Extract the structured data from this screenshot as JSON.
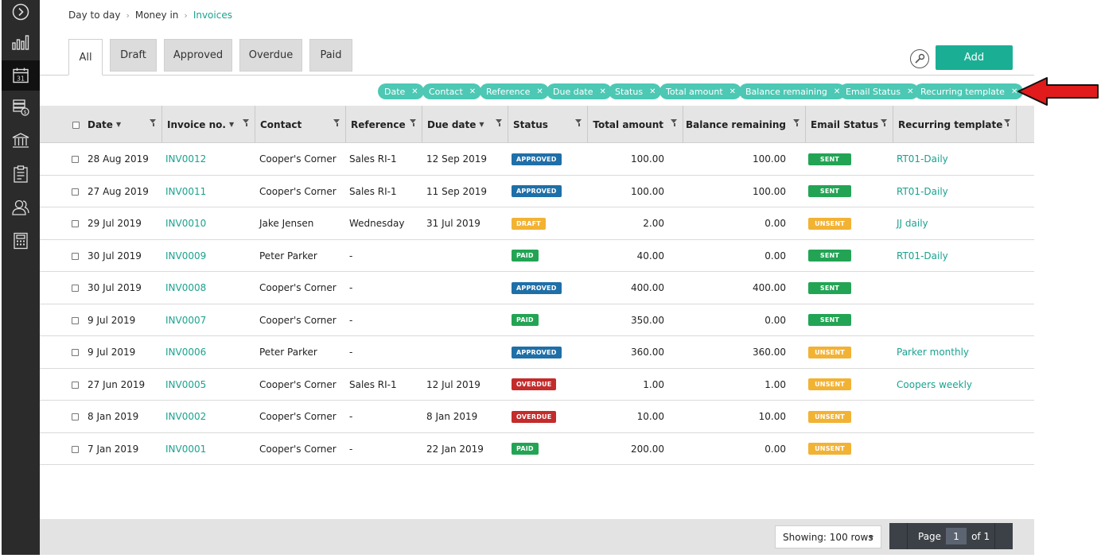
{
  "sidebar": {
    "items": [
      {
        "icon": "chevron-right-circle-icon"
      },
      {
        "icon": "bar-chart-icon"
      },
      {
        "icon": "calendar-icon",
        "text": "31",
        "active": true
      },
      {
        "icon": "money-stack-icon"
      },
      {
        "icon": "bank-icon"
      },
      {
        "icon": "clipboard-icon"
      },
      {
        "icon": "contacts-icon"
      },
      {
        "icon": "calculator-icon"
      }
    ]
  },
  "breadcrumb": {
    "items": [
      "Day to day",
      "Money in"
    ],
    "current": "Invoices"
  },
  "tabs": [
    "All",
    "Draft",
    "Approved",
    "Overdue",
    "Paid"
  ],
  "toolbar": {
    "add_label": "Add"
  },
  "column_chips": [
    "Date",
    "Contact",
    "Reference",
    "Due date",
    "Status",
    "Total amount",
    "Balance remaining",
    "Email Status",
    "Recurring template"
  ],
  "table": {
    "headers": [
      "Date",
      "Invoice no.",
      "Contact",
      "Reference",
      "Due date",
      "Status",
      "Total amount",
      "Balance remaining",
      "Email Status",
      "Recurring template"
    ],
    "rows": [
      {
        "date": "28 Aug 2019",
        "invoice": "INV0012",
        "contact": "Cooper's Corner",
        "reference": "Sales RI-1",
        "due": "12 Sep 2019",
        "status": "APPROVED",
        "total": "100.00",
        "balance": "100.00",
        "email": "SENT",
        "template": "RT01-Daily"
      },
      {
        "date": "27 Aug 2019",
        "invoice": "INV0011",
        "contact": "Cooper's Corner",
        "reference": "Sales RI-1",
        "due": "11 Sep 2019",
        "status": "APPROVED",
        "total": "100.00",
        "balance": "100.00",
        "email": "SENT",
        "template": "RT01-Daily"
      },
      {
        "date": "29 Jul 2019",
        "invoice": "INV0010",
        "contact": "Jake Jensen",
        "reference": "Wednesday",
        "due": "31 Jul 2019",
        "status": "DRAFT",
        "total": "2.00",
        "balance": "0.00",
        "email": "UNSENT",
        "template": "JJ daily"
      },
      {
        "date": "30 Jul 2019",
        "invoice": "INV0009",
        "contact": "Peter Parker",
        "reference": "-",
        "due": "",
        "status": "PAID",
        "total": "40.00",
        "balance": "0.00",
        "email": "SENT",
        "template": "RT01-Daily"
      },
      {
        "date": "30 Jul 2019",
        "invoice": "INV0008",
        "contact": "Cooper's Corner",
        "reference": "-",
        "due": "",
        "status": "APPROVED",
        "total": "400.00",
        "balance": "400.00",
        "email": "SENT",
        "template": ""
      },
      {
        "date": "9 Jul 2019",
        "invoice": "INV0007",
        "contact": "Cooper's Corner",
        "reference": "-",
        "due": "",
        "status": "PAID",
        "total": "350.00",
        "balance": "0.00",
        "email": "SENT",
        "template": ""
      },
      {
        "date": "9 Jul 2019",
        "invoice": "INV0006",
        "contact": "Peter Parker",
        "reference": "-",
        "due": "",
        "status": "APPROVED",
        "total": "360.00",
        "balance": "360.00",
        "email": "UNSENT",
        "template": "Parker monthly"
      },
      {
        "date": "27 Jun 2019",
        "invoice": "INV0005",
        "contact": "Cooper's Corner",
        "reference": "Sales RI-1",
        "due": "12 Jul 2019",
        "status": "OVERDUE",
        "total": "1.00",
        "balance": "1.00",
        "email": "UNSENT",
        "template": "Coopers weekly"
      },
      {
        "date": "8 Jan 2019",
        "invoice": "INV0002",
        "contact": "Cooper's Corner",
        "reference": "-",
        "due": "8 Jan 2019",
        "status": "OVERDUE",
        "total": "10.00",
        "balance": "10.00",
        "email": "UNSENT",
        "template": ""
      },
      {
        "date": "7 Jan 2019",
        "invoice": "INV0001",
        "contact": "Cooper's Corner",
        "reference": "-",
        "due": "22 Jan 2019",
        "status": "PAID",
        "total": "200.00",
        "balance": "0.00",
        "email": "UNSENT",
        "template": ""
      }
    ]
  },
  "status_colors": {
    "APPROVED": "#1f6fa8",
    "DRAFT": "#f2b233",
    "PAID": "#23a455",
    "OVERDUE": "#c42b2b",
    "SENT": "#23a455",
    "UNSENT": "#f2b233"
  },
  "footer": {
    "showing": "Showing: 100 rows",
    "page_label": "Page",
    "page_number": "1",
    "of_label": "of 1"
  },
  "colors": {
    "accent": "#1aaf95",
    "chip": "#4cc8b4",
    "arrow": "#e11b1b"
  }
}
